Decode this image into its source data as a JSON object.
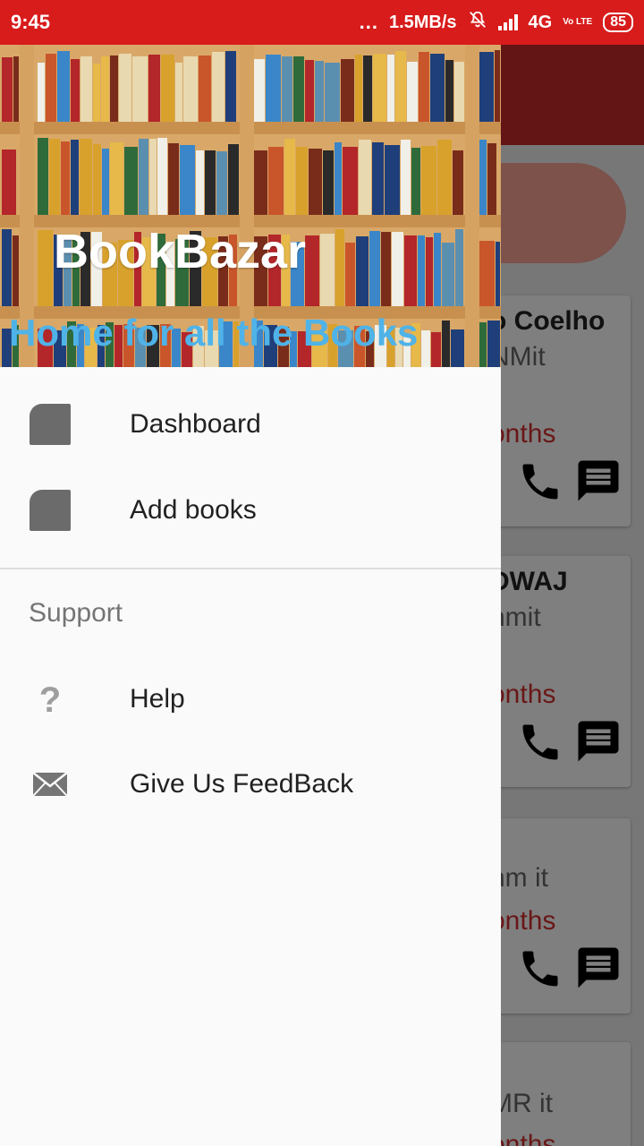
{
  "status_bar": {
    "time": "9:45",
    "dots": "...",
    "network_speed": "1.5MB/s",
    "network_type": "4G",
    "volte": "Vo LTE",
    "battery": "85"
  },
  "drawer": {
    "header": {
      "title": "BookBazar",
      "subtitle": "Home for all the Books"
    },
    "items": [
      {
        "label": "Dashboard",
        "icon": "folder-icon"
      },
      {
        "label": "Add books",
        "icon": "folder-icon"
      }
    ],
    "section_label": "Support",
    "support_items": [
      {
        "label": "Help",
        "icon": "question-icon"
      },
      {
        "label": "Give Us FeedBack",
        "icon": "mail-icon"
      }
    ]
  },
  "background_cards": [
    {
      "line1": "o Coelho",
      "line2": "NMit",
      "line3": "onths"
    },
    {
      "line1": "DWAJ",
      "line2": "nmit",
      "line3": "onths"
    },
    {
      "line1": "",
      "line2": "nm it",
      "line3": "onths"
    },
    {
      "line1": "",
      "line2": "MR it",
      "line3": "onths"
    }
  ],
  "colors": {
    "primary": "#d81b1b",
    "toolbar": "#c62828",
    "subtitle": "#4fb3e8",
    "accent_text": "#d32f2f"
  }
}
